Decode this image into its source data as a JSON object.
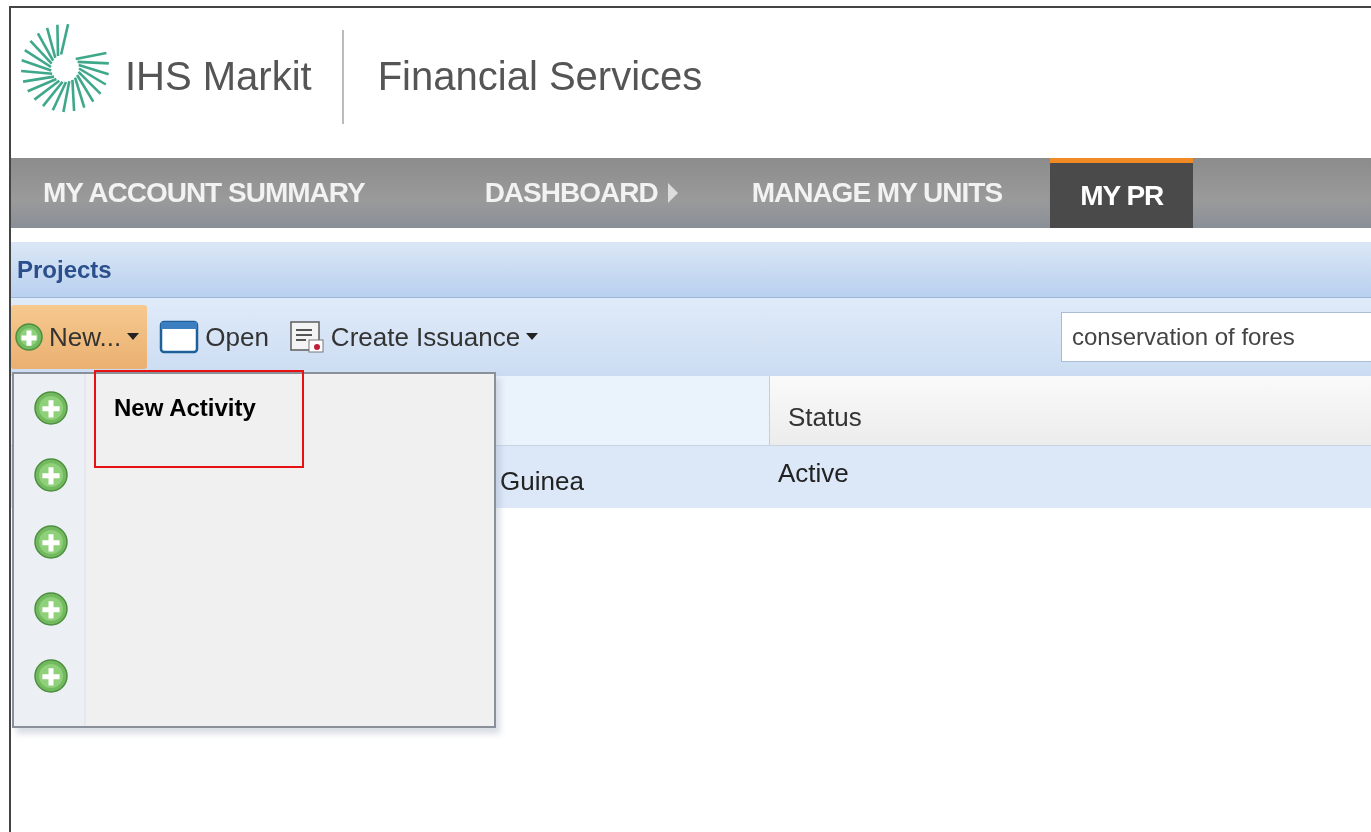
{
  "header": {
    "brand": "IHS Markit",
    "product": "Financial Services"
  },
  "nav_tabs": [
    {
      "label": "MY ACCOUNT SUMMARY",
      "selected": false,
      "arrow": false
    },
    {
      "label": "DASHBOARD",
      "selected": false,
      "arrow": true
    },
    {
      "label": "MANAGE MY UNITS",
      "selected": false,
      "arrow": false
    },
    {
      "label": "MY PR",
      "selected": true,
      "arrow": false
    }
  ],
  "panel": {
    "title": "Projects"
  },
  "toolbar": {
    "buttons": [
      {
        "kind": "new",
        "label": "New...",
        "dropdown": true,
        "pressed": true
      },
      {
        "kind": "open",
        "label": "Open",
        "dropdown": false,
        "pressed": false
      },
      {
        "kind": "issuance",
        "label": "Create Issuance",
        "dropdown": true,
        "pressed": false
      }
    ],
    "search": {
      "value": "conservation of fores"
    }
  },
  "grid": {
    "status_heading": "Status",
    "rows": [
      {
        "column_1": "Guinea",
        "status": "Active",
        "selected": true
      }
    ]
  },
  "new_menu": {
    "open": true,
    "items": [
      {
        "label": "New Activity",
        "annotated": true
      },
      {
        "annotated": false
      },
      {
        "annotated": false
      },
      {
        "annotated": false
      },
      {
        "annotated": false
      }
    ]
  }
}
